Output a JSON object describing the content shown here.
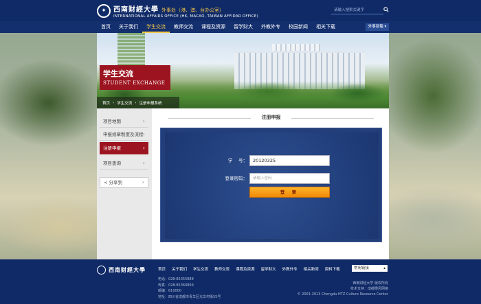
{
  "header": {
    "logo_cn": "西南财經大學",
    "logo_dept": "外事处（港、澳、台办公室）",
    "logo_en": "INTERNATIONAL AFFAIRS OFFICE (HK, MACAO, TAIWAN AFFIDAR OFFICE)",
    "search_placeholder": "请输入搜索关键字"
  },
  "nav": {
    "items": [
      "首页",
      "关于我们",
      "学生交流",
      "教师交流",
      "课程及资源",
      "留学财大",
      "外教外专",
      "校园新闻",
      "相关下载"
    ],
    "active_index": 2,
    "dropdown_label": "外事部箱 ▾"
  },
  "banner": {
    "title_cn": "学生交流",
    "title_en": "STUDENT EXCHANGE",
    "breadcrumb": [
      "首页",
      "›",
      "学生交流",
      "›",
      "注册申报系统"
    ]
  },
  "sidebar": {
    "items": [
      {
        "label": "项目地图",
        "active": false
      },
      {
        "label": "申报规章制度及流程",
        "active": false
      },
      {
        "label": "注册申报",
        "active": true
      },
      {
        "label": "项目查询",
        "active": false
      }
    ],
    "share_label": "分享到"
  },
  "form": {
    "section_title": "注册申报",
    "student_id_label": "学　 号：",
    "student_id_value": "20120325",
    "password_label": "登录密码：",
    "password_placeholder": "请输入密码",
    "submit_label": "登 录"
  },
  "footer": {
    "logo_text": "西南财經大學",
    "nav": [
      "首页",
      "关于我们",
      "学生交流",
      "教师交流",
      "课程及资源",
      "留学财大",
      "外教外专",
      "相关新闻",
      "资料下载"
    ],
    "select_label": "常用链接",
    "contact": [
      "电话：028-85355888",
      "传真：028-85360899",
      "邮编：610000",
      "地址：四川省成都市青羊区光华村街55号"
    ],
    "credits": [
      "西南财经大学 版权所有",
      "技术支持：成都橙风网络",
      "© 2001-2013 Chengdu HTZ Culture Resource Center"
    ]
  },
  "colors": {
    "navy": "#0f2a66",
    "accent_red": "#9c1420",
    "accent_gold": "#f7c948",
    "button_orange": "#f08a06"
  }
}
